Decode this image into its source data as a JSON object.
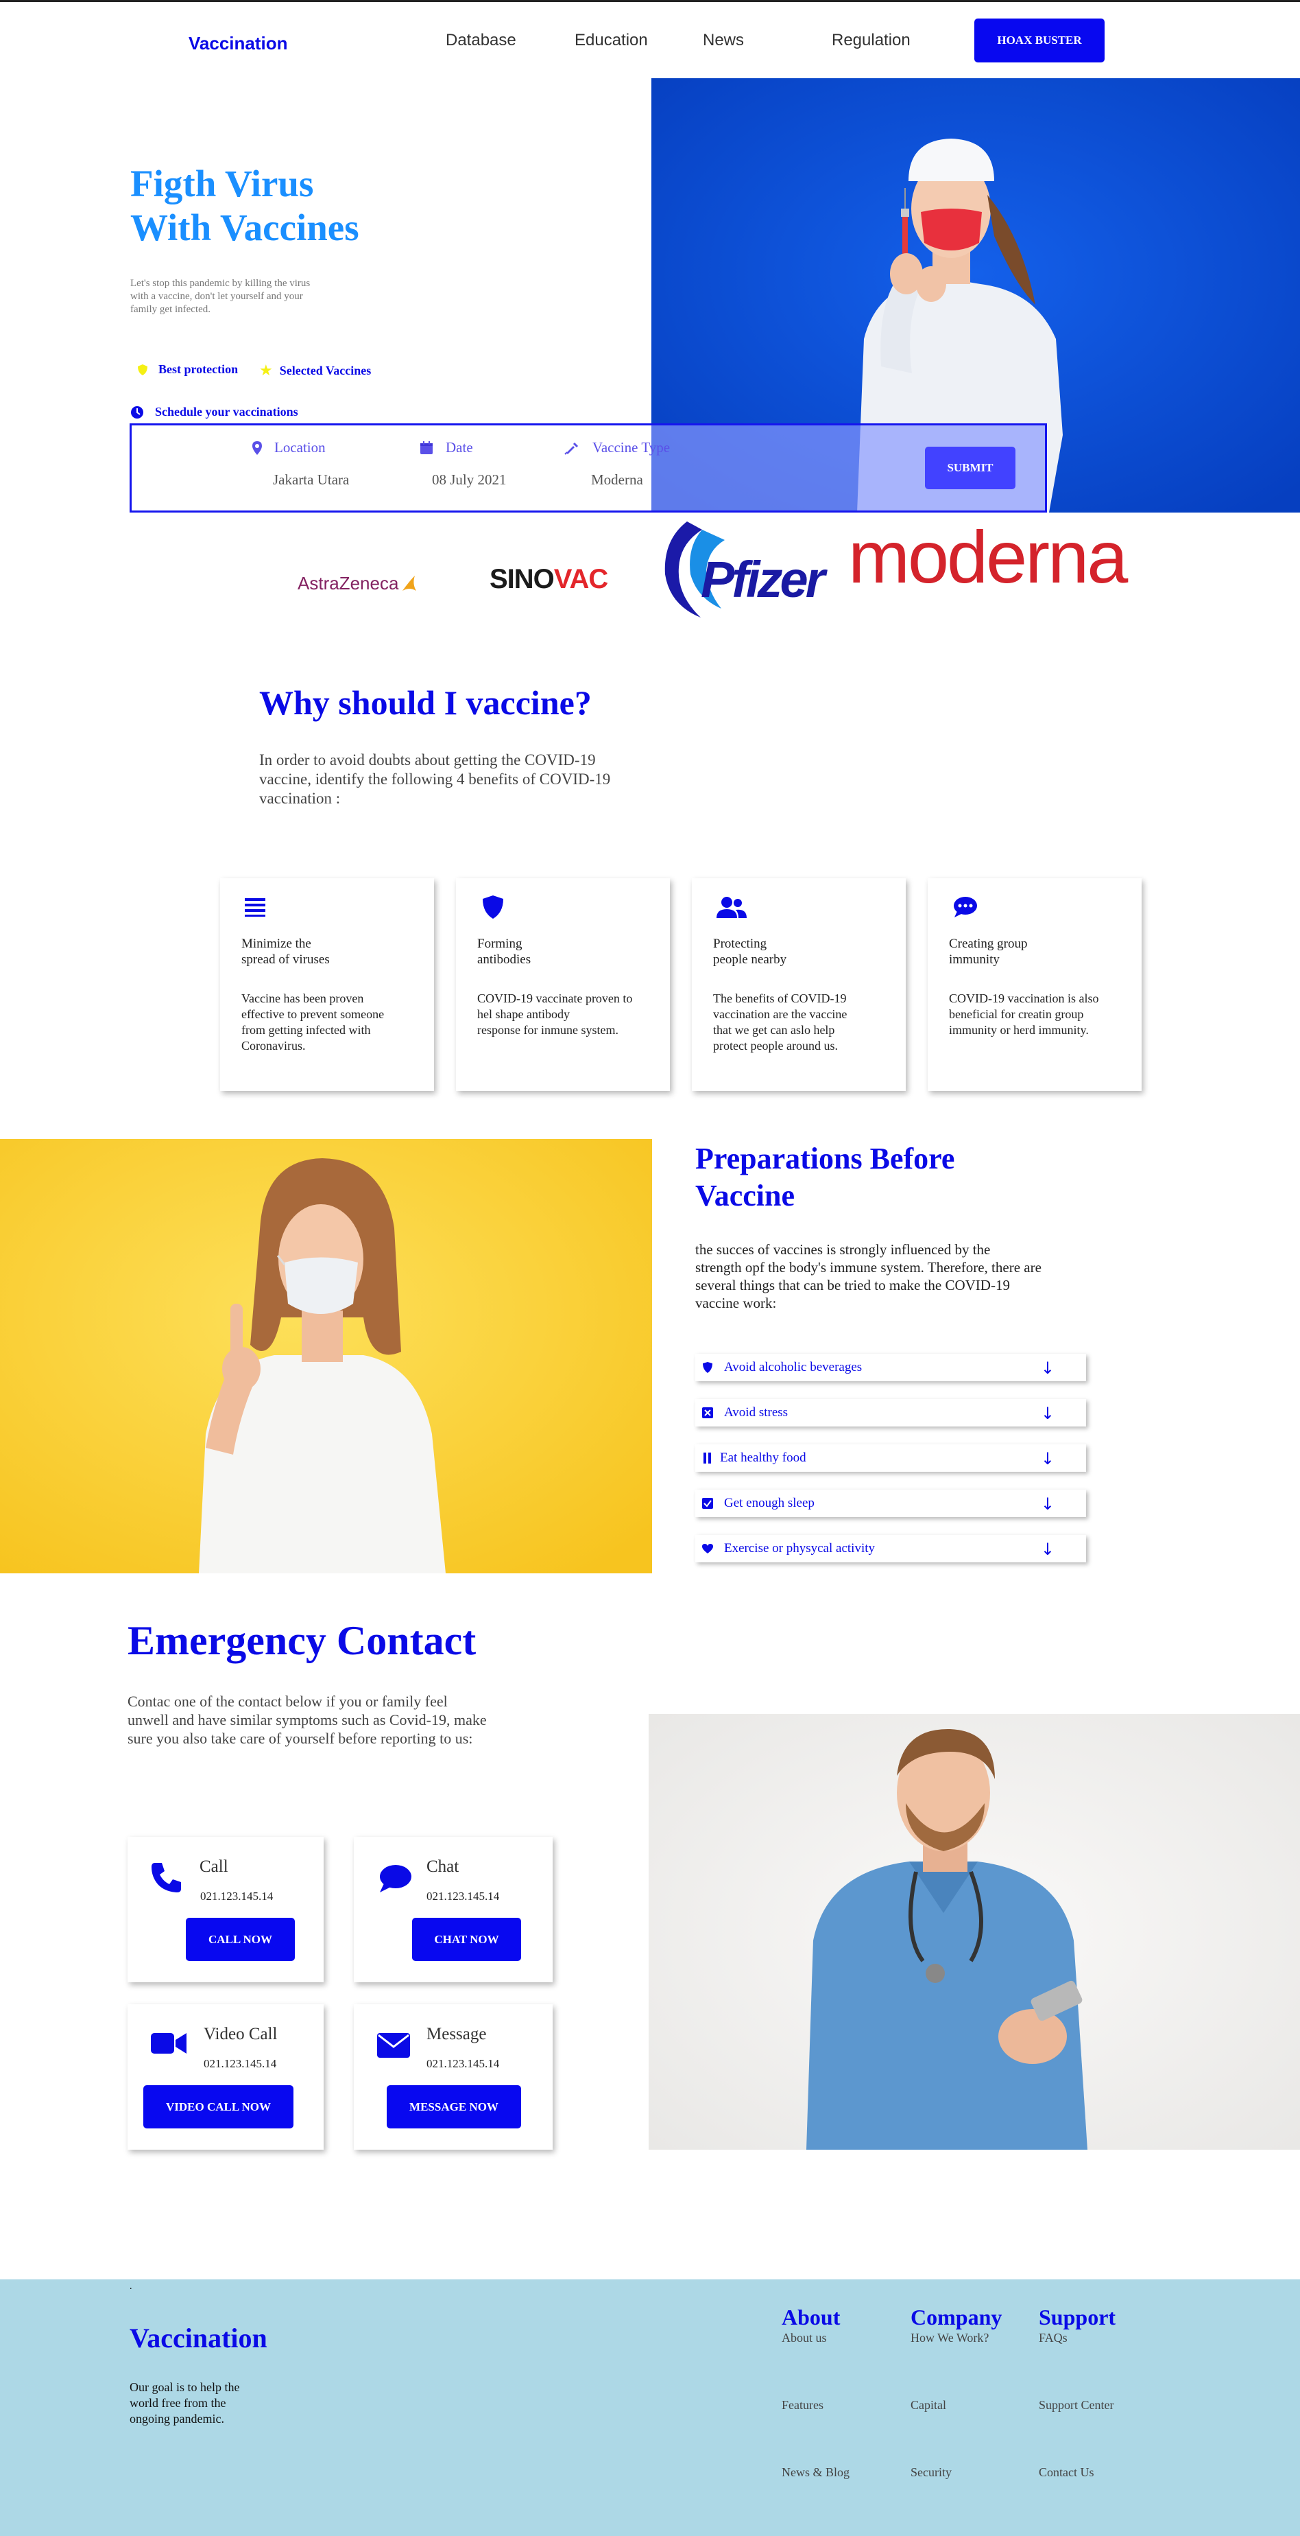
{
  "nav": {
    "brand": "Vaccination",
    "links": [
      "Database",
      "Education",
      "News",
      "Regulation"
    ],
    "cta": "HOAX BUSTER"
  },
  "hero": {
    "title_line1": "Figth Virus",
    "title_line2": "With Vaccines",
    "desc_line1": "Let's stop this pandemic by killing the virus",
    "desc_line2": "with a vaccine, don't let yourself and your",
    "desc_line3": "family get infected.",
    "badge1": "Best protection",
    "badge2": "Selected Vaccines",
    "schedule_label": "Schedule your vaccinations"
  },
  "schedule": {
    "location_label": "Location",
    "location_value": "Jakarta Utara",
    "date_label": "Date",
    "date_value": "08 July 2021",
    "vaccine_label": "Vaccine Type",
    "vaccine_value": "Moderna",
    "submit": "SUBMIT"
  },
  "brands": [
    "AstraZeneca",
    "SINO",
    "VAC",
    "Pfizer",
    "moderna"
  ],
  "why": {
    "title": "Why should I vaccine?",
    "desc_line1": "In order to avoid doubts about getting the COVID-19",
    "desc_line2": "vaccine, identify the following 4 benefits of COVID-19",
    "desc_line3": "vaccination :",
    "cards": [
      {
        "t1": "Minimize the",
        "t2": "spread of viruses",
        "b": [
          "Vaccine has been proven",
          "effective to prevent someone",
          "from getting infected with",
          "Coronavirus."
        ],
        "icon": "list-icon"
      },
      {
        "t1": "Forming",
        "t2": "antibodies",
        "b": [
          "COVID-19 vaccinate proven to",
          "hel shape antibody",
          "response for inmune system."
        ],
        "icon": "shield-icon"
      },
      {
        "t1": "Protecting",
        "t2": "people nearby",
        "b": [
          "The benefits of COVID-19",
          "vaccination are the vaccine",
          "that we get can aslo help",
          "protect people around us."
        ],
        "icon": "users-icon"
      },
      {
        "t1": "Creating group",
        "t2": "immunity",
        "b": [
          "COVID-19 vaccination is also",
          "beneficial for creatin group",
          "immunity or herd immunity."
        ],
        "icon": "chat-bubble-icon"
      }
    ]
  },
  "prep": {
    "title_line1": "Preparations Before",
    "title_line2": "Vaccine",
    "desc_line1": "the succes of vaccines is strongly influenced by the",
    "desc_line2": "strength opf the body's immune system. Therefore, there are",
    "desc_line3": "several things that can be tried to make the COVID-19",
    "desc_line4": "vaccine work:",
    "items": [
      "Avoid alcoholic beverages",
      "Avoid stress",
      "Eat healthy food",
      "Get enough sleep",
      "Exercise or physycal activity"
    ]
  },
  "emergency": {
    "title": "Emergency Contact",
    "desc_line1": "Contac one of the contact below if you or family feel",
    "desc_line2": "unwell and have similar symptoms such as Covid-19, make",
    "desc_line3": "sure you also take care of yourself before reporting to us:",
    "call": {
      "title": "Call",
      "number": "021.123.145.14",
      "btn": "CALL NOW"
    },
    "chat": {
      "title": "Chat",
      "number": "021.123.145.14",
      "btn": "CHAT NOW"
    },
    "video": {
      "title": "Video Call",
      "number": "021.123.145.14",
      "btn": "VIDEO CALL NOW"
    },
    "message": {
      "title": "Message",
      "number": "021.123.145.14",
      "btn": "MESSAGE NOW"
    }
  },
  "footer": {
    "dot": ".",
    "brand": "Vaccination",
    "desc_line1": "Our goal is to help the",
    "desc_line2": "world free from the",
    "desc_line3": "ongoing pandemic.",
    "about": {
      "title": "About",
      "links": [
        "About us",
        "Features",
        "News & Blog"
      ]
    },
    "company": {
      "title": "Company",
      "links": [
        "How We Work?",
        "Capital",
        "Security"
      ]
    },
    "support": {
      "title": "Support",
      "links": [
        "FAQs",
        "Support Center",
        "Contact Us"
      ]
    }
  },
  "colors": {
    "accent": "#0a0ae6",
    "hero_bg": "#0a4fd6",
    "yellow": "#fcd22e",
    "footer_bg": "#add8e6"
  }
}
